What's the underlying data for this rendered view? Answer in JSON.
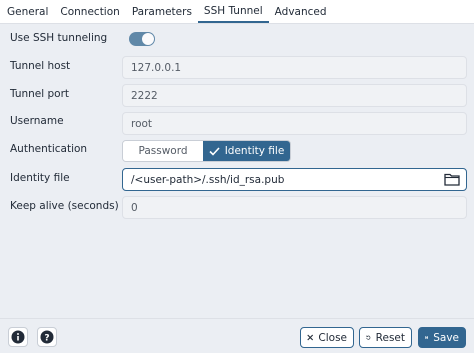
{
  "tabs": [
    {
      "label": "General",
      "active": false
    },
    {
      "label": "Connection",
      "active": false
    },
    {
      "label": "Parameters",
      "active": false
    },
    {
      "label": "SSH Tunnel",
      "active": true
    },
    {
      "label": "Advanced",
      "active": false
    }
  ],
  "form": {
    "use_ssh": {
      "label": "Use SSH tunneling",
      "enabled": true
    },
    "tunnel_host": {
      "label": "Tunnel host",
      "value": "127.0.0.1"
    },
    "tunnel_port": {
      "label": "Tunnel port",
      "value": "2222"
    },
    "username": {
      "label": "Username",
      "value": "root"
    },
    "authentication": {
      "label": "Authentication",
      "options": [
        "Password",
        "Identity file"
      ],
      "selected": "Identity file"
    },
    "identity_file": {
      "label": "Identity file",
      "value": "/<user-path>/.ssh/id_rsa.pub"
    },
    "keep_alive": {
      "label": "Keep alive (seconds)",
      "value": "0"
    }
  },
  "footer": {
    "info_icon": "info-icon",
    "help_icon": "help-icon",
    "close_label": "Close",
    "reset_label": "Reset",
    "save_label": "Save"
  },
  "colors": {
    "accent": "#326690",
    "background": "#ebeef3"
  }
}
